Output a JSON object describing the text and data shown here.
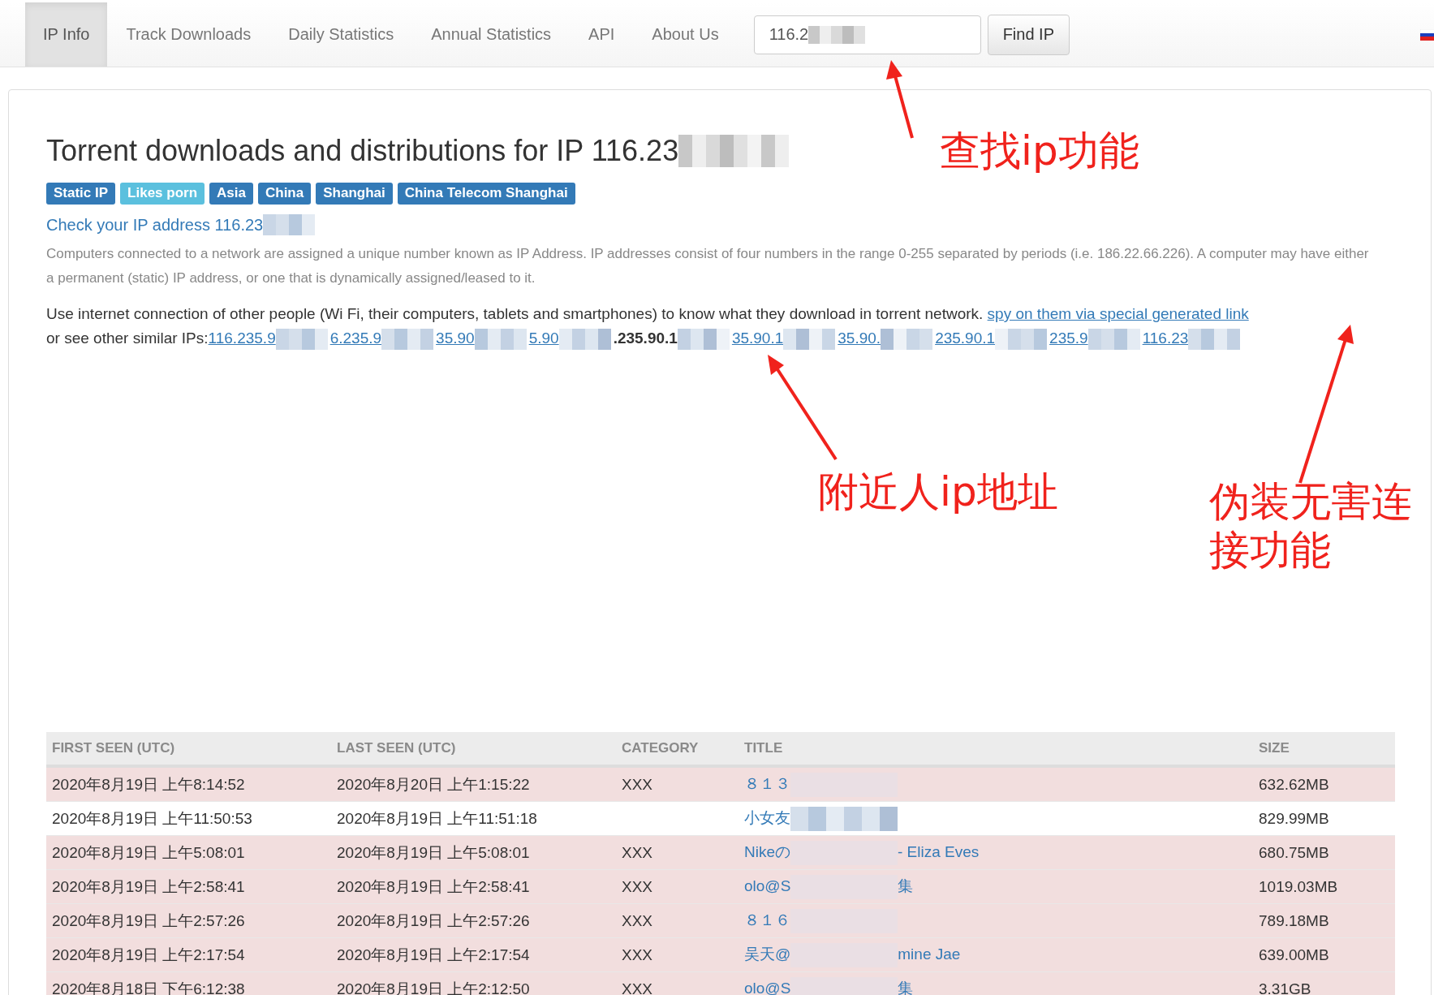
{
  "nav": {
    "items": [
      {
        "label": "IP Info",
        "selected": true
      },
      {
        "label": "Track Downloads",
        "selected": false
      },
      {
        "label": "Daily Statistics",
        "selected": false
      },
      {
        "label": "Annual Statistics",
        "selected": false
      },
      {
        "label": "API",
        "selected": false
      },
      {
        "label": "About Us",
        "selected": false
      }
    ],
    "search": {
      "value": "116.2"
    },
    "find_button": "Find IP"
  },
  "heading": "Torrent downloads and distributions for IP 116.23",
  "badges": [
    {
      "label": "Static IP",
      "color": "#337ab7"
    },
    {
      "label": "Likes porn",
      "color": "#5bc0de"
    },
    {
      "label": "Asia",
      "color": "#337ab7"
    },
    {
      "label": "China",
      "color": "#337ab7"
    },
    {
      "label": "Shanghai",
      "color": "#337ab7"
    },
    {
      "label": "China Telecom Shanghai",
      "color": "#337ab7"
    }
  ],
  "check_link": "Check your IP address 116.23",
  "explanation": "Computers connected to a network are assigned a unique number known as IP Address. IP addresses consist of four numbers in the range 0-255 separated by periods (i.e. 186.22.66.226). A computer may have either a permanent (static) IP address, or one that is dynamically assigned/leased to it.",
  "usage_text": "Use internet connection of other people (Wi Fi, their computers, tablets and smartphones) to know what they download in torrent network.",
  "spy_link": "spy on them via special generated link",
  "similar_label": "or see other similar IPs:",
  "similar_ips": [
    {
      "text": "116.235.9",
      "current": false
    },
    {
      "text": "6.235.9",
      "current": false
    },
    {
      "text": "35.90",
      "current": false
    },
    {
      "text": "5.90",
      "current": false
    },
    {
      "text": ".235.90.1",
      "current": true
    },
    {
      "text": "35.90.1",
      "current": false
    },
    {
      "text": "35.90.",
      "current": false
    },
    {
      "text": "235.90.1",
      "current": false
    },
    {
      "text": "235.9",
      "current": false
    },
    {
      "text": "116.23",
      "current": false
    }
  ],
  "table": {
    "columns": [
      "FIRST SEEN (UTC)",
      "LAST SEEN (UTC)",
      "CATEGORY",
      "TITLE",
      "SIZE"
    ],
    "rows": [
      {
        "first_seen": "2020年8月19日 上午8:14:52",
        "last_seen": "2020年8月20日 上午1:15:22",
        "category": "XXX",
        "title": [
          "８１３"
        ],
        "size": "632.62MB",
        "highlighted": true
      },
      {
        "first_seen": "2020年8月19日 上午11:50:53",
        "last_seen": "2020年8月19日 上午11:51:18",
        "title": [
          "小女友"
        ],
        "size": "829.99MB",
        "highlighted": false
      },
      {
        "first_seen": "2020年8月19日 上午5:08:01",
        "last_seen": "2020年8月19日 上午5:08:01",
        "category": "XXX",
        "title": [
          "Nikeの",
          "- Eliza Eves"
        ],
        "size": "680.75MB",
        "highlighted": true
      },
      {
        "first_seen": "2020年8月19日 上午2:58:41",
        "last_seen": "2020年8月19日 上午2:58:41",
        "category": "XXX",
        "title": [
          "olo@S",
          "集"
        ],
        "size": "1019.03MB",
        "highlighted": true
      },
      {
        "first_seen": "2020年8月19日 上午2:57:26",
        "last_seen": "2020年8月19日 上午2:57:26",
        "category": "XXX",
        "title": [
          "８１６"
        ],
        "size": "789.18MB",
        "highlighted": true
      },
      {
        "first_seen": "2020年8月19日 上午2:17:54",
        "last_seen": "2020年8月19日 上午2:17:54",
        "category": "XXX",
        "title": [
          "吴天@",
          "mine Jae"
        ],
        "size": "639.00MB",
        "highlighted": true
      },
      {
        "first_seen": "2020年8月18日 下午6:12:38",
        "last_seen": "2020年8月19日 上午2:12:50",
        "category": "XXX",
        "title": [
          "olo@S",
          "集"
        ],
        "size": "3.31GB",
        "highlighted": true
      }
    ]
  },
  "annotations": [
    "查找ip功能",
    "附近人ip地址",
    "伪装无害连接功能"
  ]
}
